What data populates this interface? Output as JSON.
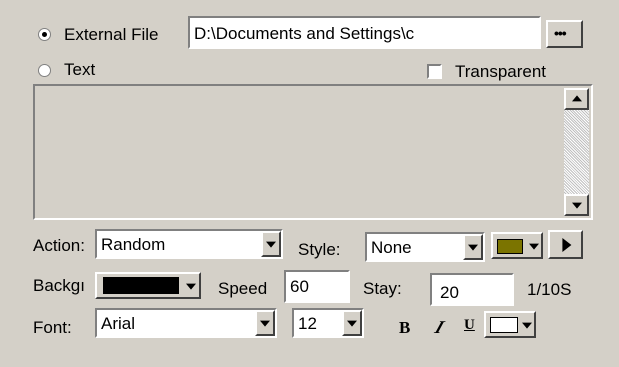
{
  "source": {
    "external_label": "External File",
    "path_value": "D:\\Documents and Settings\\c",
    "browse_label": "•••",
    "text_label": "Text",
    "transparent_label": "Transparent"
  },
  "action": {
    "label": "Action:",
    "value": "Random"
  },
  "style": {
    "label": "Style:",
    "value": "None",
    "color": "#7b7400"
  },
  "background": {
    "label": "Backgı",
    "color": "#000000"
  },
  "speed": {
    "label": "Speed",
    "value": "60"
  },
  "stay": {
    "label": "Stay:",
    "value": "20",
    "unit": "1/10S"
  },
  "font": {
    "label": "Font:",
    "value": "Arial",
    "size": "12",
    "bold_label": "B",
    "italic_label": "I",
    "underline_label": "U",
    "color": "#ffffff"
  }
}
